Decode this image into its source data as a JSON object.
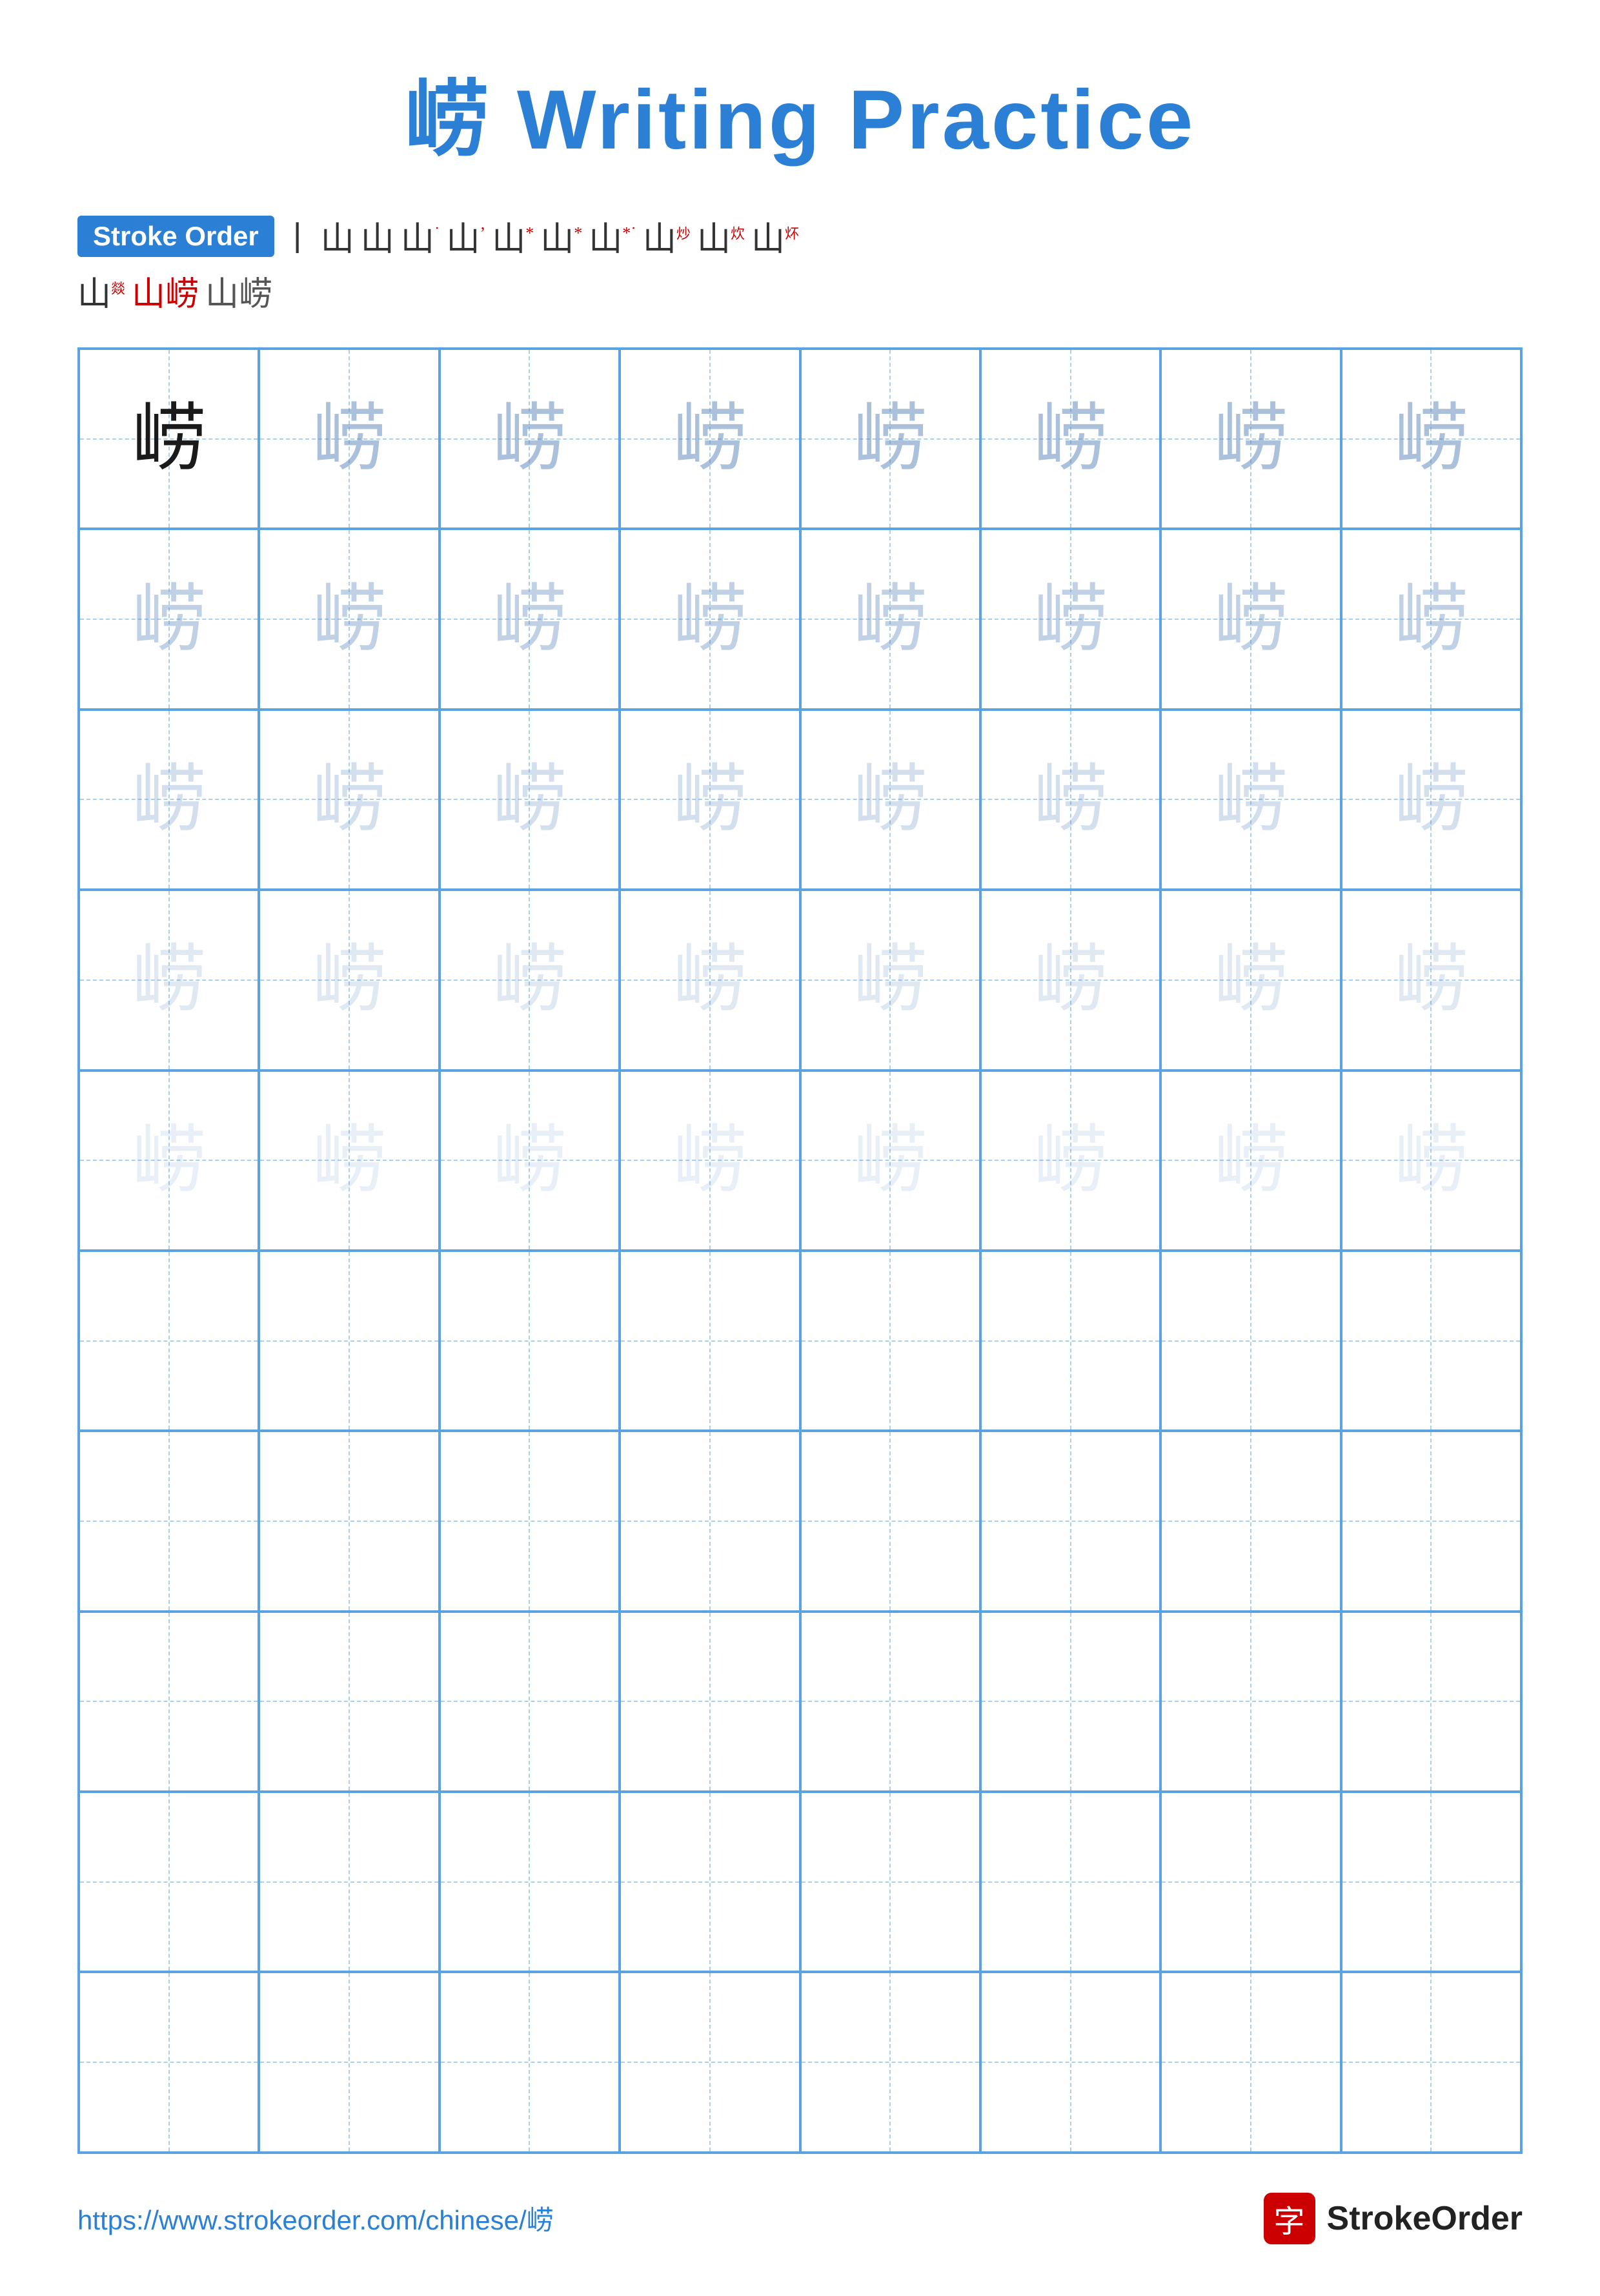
{
  "title": "崂 Writing Practice",
  "stroke_order": {
    "badge_label": "Stroke Order",
    "steps": [
      "丨",
      "山",
      "山",
      "山˙",
      "山ʼ",
      "山*",
      "山*",
      "山*˙",
      "山炒",
      "山炊",
      "山炋",
      "山燚",
      "山崂",
      "山崂"
    ],
    "final_chars": [
      "山燚",
      "山崂",
      "山崂"
    ]
  },
  "character": "崂",
  "grid": {
    "cols": 8,
    "rows": 10,
    "practice_rows": [
      {
        "type": "dark",
        "count": 1
      },
      {
        "type": "gray1",
        "count": 7
      },
      {
        "type": "gray2",
        "count": 8
      },
      {
        "type": "gray3",
        "count": 8
      },
      {
        "type": "gray4",
        "count": 8
      },
      {
        "type": "gray5",
        "count": 8
      },
      {
        "type": "empty",
        "count": 8
      },
      {
        "type": "empty",
        "count": 8
      },
      {
        "type": "empty",
        "count": 8
      },
      {
        "type": "empty",
        "count": 8
      },
      {
        "type": "empty",
        "count": 8
      }
    ]
  },
  "footer": {
    "url": "https://www.strokeorder.com/chinese/崂",
    "brand_icon": "字",
    "brand_name": "StrokeOrder"
  }
}
